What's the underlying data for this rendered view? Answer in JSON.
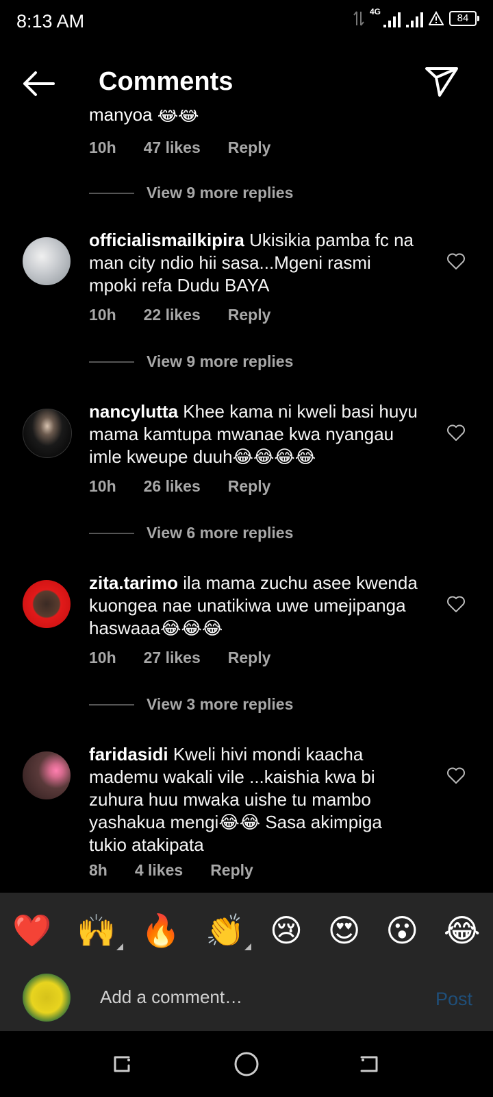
{
  "status_bar": {
    "time": "8:13 AM",
    "network": "4G",
    "battery": "84"
  },
  "header": {
    "title": "Comments"
  },
  "partial_comment": {
    "text": "manyoa 😂😂",
    "time": "10h",
    "likes": "47 likes",
    "reply": "Reply",
    "view_more": "View 9 more replies"
  },
  "comments": [
    {
      "username": "officialismailkipira",
      "text": "Ukisikia pamba fc na man city ndio hii sasa...Mgeni rasmi mpoki refa Dudu BAYA",
      "time": "10h",
      "likes": "22 likes",
      "reply": "Reply",
      "view_more": "View 9 more replies"
    },
    {
      "username": "nancylutta",
      "text": "Khee kama ni kweli basi huyu mama kamtupa mwanae kwa nyangau imle kweupe duuh😂😂😂😂",
      "time": "10h",
      "likes": "26 likes",
      "reply": "Reply",
      "view_more": "View 6 more replies"
    },
    {
      "username": "zita.tarimo",
      "text": "ila mama zuchu  asee kwenda kuongea nae unatikiwa uwe umejipanga haswaaa😂😂😂",
      "time": "10h",
      "likes": "27 likes",
      "reply": "Reply",
      "view_more": "View 3 more replies"
    },
    {
      "username": "faridasidi",
      "text": "Kweli hivi mondi kaacha mademu wakali vile ...kaishia kwa bi zuhura huu mwaka uishe tu mambo yashakua mengi😂😂 Sasa akimpiga tukio atakipata",
      "time": "8h",
      "likes": "4 likes",
      "reply": "Reply"
    }
  ],
  "emoji_bar": [
    "❤️",
    "🙌",
    "🔥",
    "👏",
    "😢",
    "😍",
    "😮",
    "😂"
  ],
  "compose": {
    "placeholder": "Add a comment…",
    "post_label": "Post"
  },
  "colors": {
    "background": "#000000",
    "panel": "#262626",
    "muted_text": "#a8a8a8",
    "post_disabled": "#1f4f7a"
  }
}
